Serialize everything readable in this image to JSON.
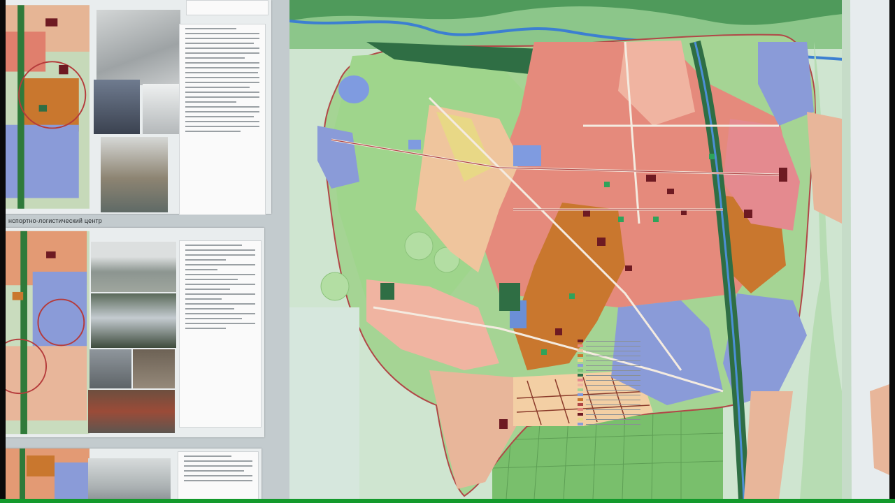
{
  "scene": {
    "description_label": "",
    "border_color": "#139a2c"
  },
  "left_board": {
    "section_label": "нспортно-логистический центр",
    "posters": [
      {
        "id": "top"
      },
      {
        "id": "middle"
      },
      {
        "id": "bottom"
      }
    ]
  },
  "main_map": {
    "colors": {
      "residential_low": "#e9b79a",
      "residential_mid": "#e58a7c",
      "industrial": "#c9772e",
      "public": "#6e1a22",
      "green": "#7fc777",
      "dark_green": "#2f6e44",
      "water": "#7f9be0",
      "agri": "#a7d695",
      "yellow": "#e8d886",
      "roads": "#f4ebe0",
      "boundary": "#b14747"
    }
  },
  "right_strip": {
    "text_1": "",
    "text_2": ""
  }
}
